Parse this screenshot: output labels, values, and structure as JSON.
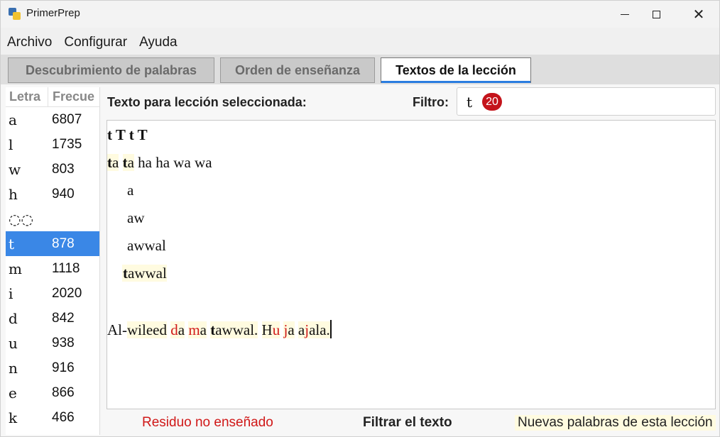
{
  "window": {
    "title": "PrimerPrep",
    "minimize_label": "",
    "close_label": "✕"
  },
  "menu": [
    "Archivo",
    "Configurar",
    "Ayuda"
  ],
  "tabs": [
    {
      "label": "Descubrimiento de palabras",
      "active": false
    },
    {
      "label": "Orden de enseñanza",
      "active": false
    },
    {
      "label": "Textos de la lección",
      "active": true
    }
  ],
  "letters_table": {
    "header_letter": "Letra",
    "header_freq": "Frecue",
    "rows": [
      {
        "letter": "a",
        "freq": "6807"
      },
      {
        "letter": "l",
        "freq": "1735"
      },
      {
        "letter": "w",
        "freq": "803"
      },
      {
        "letter": "h",
        "freq": "940"
      },
      {
        "letter": "◌◌",
        "freq": ""
      },
      {
        "letter": "t",
        "freq": "878",
        "selected": true
      },
      {
        "letter": "m",
        "freq": "1118"
      },
      {
        "letter": "i",
        "freq": "2020"
      },
      {
        "letter": "d",
        "freq": "842"
      },
      {
        "letter": "u",
        "freq": "938"
      },
      {
        "letter": "n",
        "freq": "916"
      },
      {
        "letter": "e",
        "freq": "866"
      },
      {
        "letter": "k",
        "freq": "466"
      }
    ]
  },
  "lesson": {
    "label": "Texto para lección seleccionada:",
    "filter_label": "Filtro:",
    "filter_value": "t",
    "filter_count": "20",
    "text_lines": [
      "t T t T",
      "ta ta ha ha wa wa",
      "a",
      "aw",
      "awwal",
      "tawwal",
      "",
      "Al-wileed da ma tawwal. Hu ja ajala."
    ]
  },
  "footer": {
    "untaught_residue": "Residuo no enseñado",
    "filter_text": "Filtrar el texto",
    "new_words": "Nuevas palabras de esta lección"
  },
  "colors": {
    "accent": "#2b7de0",
    "selected_row": "#3a87e6",
    "residue_red": "#d01818",
    "new_word_highlight": "#fffbe0",
    "badge": "#c4141b"
  }
}
